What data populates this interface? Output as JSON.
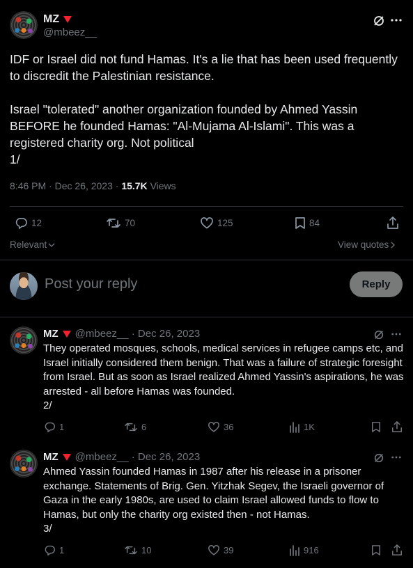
{
  "main_post": {
    "author_name": "MZ",
    "author_handle": "@mbeez__",
    "text": "IDF or Israel did not fund Hamas. It's a lie that has been used frequently to discredit the Palestinian resistance.\n\nIsrael \"tolerated\" another organization founded by Ahmed Yassin BEFORE he founded Hamas: \"Al-Mujama Al-Islami\". This was a registered charity org. Not political\n1/",
    "time": "8:46 PM · Dec 26, 2023 · ",
    "views_count": "15.7K",
    "views_label": "Views",
    "replies": "12",
    "reposts": "70",
    "likes": "125",
    "bookmarks": "84"
  },
  "sort": {
    "label": "Relevant",
    "view_quotes": "View quotes"
  },
  "composer": {
    "placeholder": "Post your reply",
    "reply_button": "Reply"
  },
  "replies": [
    {
      "author_name": "MZ",
      "meta": "@mbeez__ · Dec 26, 2023",
      "text": "They operated mosques, schools, medical services in refugee camps etc, and Israel initially considered them benign. That was a failure of strategic foresight from Israel. But as soon as Israel realized Ahmed Yassin's aspirations, he was arrested - all before Hamas was founded.\n2/",
      "replies": "1",
      "reposts": "6",
      "likes": "36",
      "views": "1K"
    },
    {
      "author_name": "MZ",
      "meta": "@mbeez__ · Dec 26, 2023",
      "text": "Ahmed Yassin founded Hamas in 1987 after his release in a prisoner exchange. Statements of Brig. Gen. Yitzhak Segev, the Israeli governor of Gaza in the early 1980s, are used to claim Israel allowed funds to flow to Hamas, but only the charity org existed then - not Hamas.\n3/",
      "replies": "1",
      "reposts": "10",
      "likes": "39",
      "views": "916"
    }
  ]
}
